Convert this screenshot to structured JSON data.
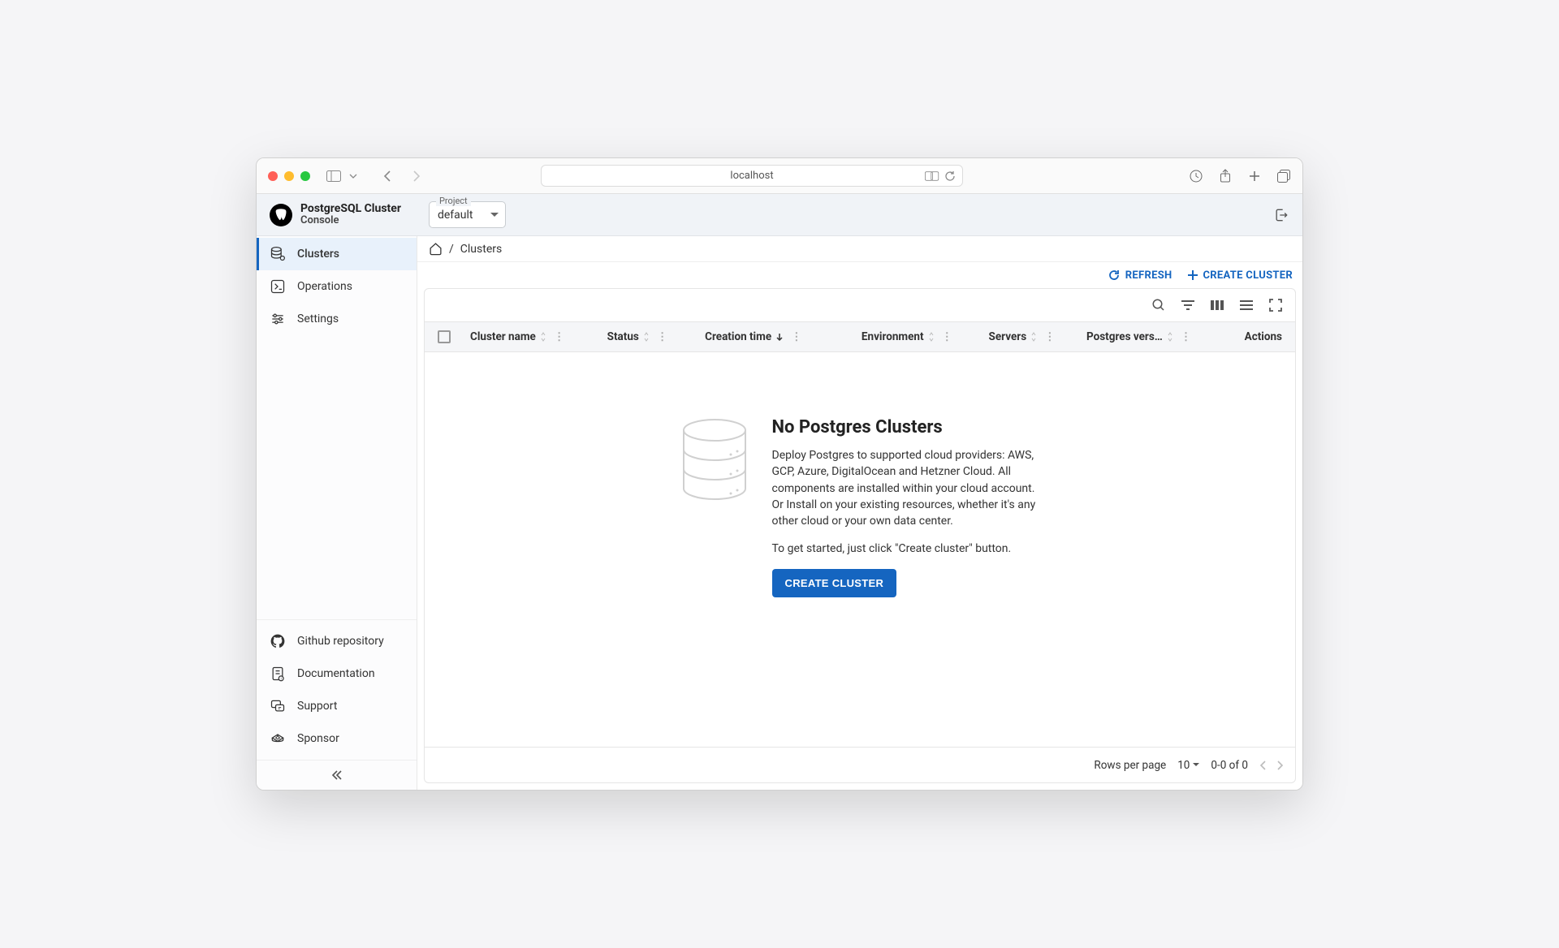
{
  "browser": {
    "url": "localhost"
  },
  "app": {
    "title": "PostgreSQL Cluster",
    "subtitle": "Console",
    "project_label": "Project",
    "project_value": "default"
  },
  "sidebar": {
    "nav": [
      {
        "label": "Clusters"
      },
      {
        "label": "Operations"
      },
      {
        "label": "Settings"
      }
    ],
    "bottom": [
      {
        "label": "Github repository"
      },
      {
        "label": "Documentation"
      },
      {
        "label": "Support"
      },
      {
        "label": "Sponsor"
      }
    ]
  },
  "breadcrumb": {
    "sep": "/",
    "current": "Clusters"
  },
  "actions": {
    "refresh": "REFRESH",
    "create": "CREATE CLUSTER"
  },
  "table": {
    "columns": {
      "cluster_name": "Cluster name",
      "status": "Status",
      "creation_time": "Creation time",
      "environment": "Environment",
      "servers": "Servers",
      "postgres_version": "Postgres vers…",
      "actions": "Actions"
    }
  },
  "empty": {
    "title": "No Postgres Clusters",
    "para1": "Deploy Postgres to supported cloud providers: AWS, GCP, Azure, DigitalOcean and Hetzner Cloud. All components are installed within your cloud account. Or Install on your existing resources, whether it's any other cloud or your own data center.",
    "para2": "To get started, just click \"Create cluster\" button.",
    "button": "CREATE CLUSTER"
  },
  "footer": {
    "rows_label": "Rows per page",
    "rows_value": "10",
    "range": "0-0 of 0"
  }
}
